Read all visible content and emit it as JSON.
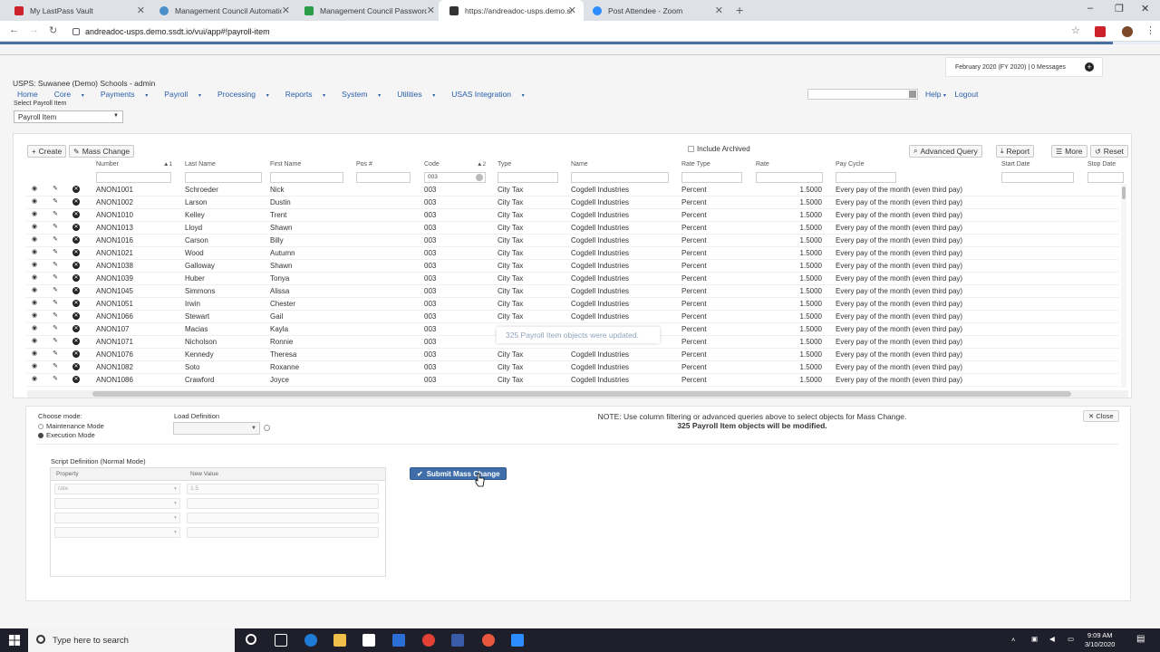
{
  "browser": {
    "tabs": [
      {
        "title": "My LastPass Vault",
        "color": "#cc2229"
      },
      {
        "title": "Management Council Automatio",
        "color": "#4a8fc7"
      },
      {
        "title": "Management Council Password",
        "color": "#2a9d4a"
      },
      {
        "title": "https://andreadoc-usps.demo.ss",
        "color": "#333333"
      },
      {
        "title": "Post Attendee - Zoom",
        "color": "#2d8cff"
      }
    ],
    "url": "andreadoc-usps.demo.ssdt.io/vui/app#!payroll-item"
  },
  "header": {
    "title": "USPS: Suwanee (Demo) Schools - admin",
    "status": "February 2020 (FY 2020) | 0 Messages",
    "menu": [
      "Home",
      "Core",
      "Payments",
      "Payroll",
      "Processing",
      "Reports",
      "System",
      "Utilities",
      "USAS Integration"
    ],
    "help": "Help",
    "logout": "Logout",
    "select_label": "Select Payroll Item",
    "select_value": "Payroll Item"
  },
  "toolbar": {
    "create": "Create",
    "mass_change": "Mass Change",
    "include_archived": "Include Archived",
    "advanced_query": "Advanced Query",
    "report": "Report",
    "more": "More",
    "reset": "Reset"
  },
  "grid": {
    "columns": [
      "Number",
      "Last Name",
      "First Name",
      "Pos #",
      "Code",
      "Type",
      "Name",
      "Rate Type",
      "Rate",
      "Pay Cycle",
      "Start Date",
      "Stop Date"
    ],
    "sort_number": "1",
    "sort_code": "2",
    "code_filter": "003",
    "rows": [
      {
        "number": "ANON1001",
        "last": "Schroeder",
        "first": "Nick",
        "code": "003",
        "type": "City Tax",
        "name": "Cogdell Industries",
        "rate_type": "Percent",
        "rate": "1.5000",
        "cycle": "Every pay of the month (even third pay)"
      },
      {
        "number": "ANON1002",
        "last": "Larson",
        "first": "Dustin",
        "code": "003",
        "type": "City Tax",
        "name": "Cogdell Industries",
        "rate_type": "Percent",
        "rate": "1.5000",
        "cycle": "Every pay of the month (even third pay)"
      },
      {
        "number": "ANON1010",
        "last": "Kelley",
        "first": "Trent",
        "code": "003",
        "type": "City Tax",
        "name": "Cogdell Industries",
        "rate_type": "Percent",
        "rate": "1.5000",
        "cycle": "Every pay of the month (even third pay)"
      },
      {
        "number": "ANON1013",
        "last": "Lloyd",
        "first": "Shawn",
        "code": "003",
        "type": "City Tax",
        "name": "Cogdell Industries",
        "rate_type": "Percent",
        "rate": "1.5000",
        "cycle": "Every pay of the month (even third pay)"
      },
      {
        "number": "ANON1016",
        "last": "Carson",
        "first": "Billy",
        "code": "003",
        "type": "City Tax",
        "name": "Cogdell Industries",
        "rate_type": "Percent",
        "rate": "1.5000",
        "cycle": "Every pay of the month (even third pay)"
      },
      {
        "number": "ANON1021",
        "last": "Wood",
        "first": "Autumn",
        "code": "003",
        "type": "City Tax",
        "name": "Cogdell Industries",
        "rate_type": "Percent",
        "rate": "1.5000",
        "cycle": "Every pay of the month (even third pay)"
      },
      {
        "number": "ANON1038",
        "last": "Galloway",
        "first": "Shawn",
        "code": "003",
        "type": "City Tax",
        "name": "Cogdell Industries",
        "rate_type": "Percent",
        "rate": "1.5000",
        "cycle": "Every pay of the month (even third pay)"
      },
      {
        "number": "ANON1039",
        "last": "Huber",
        "first": "Tonya",
        "code": "003",
        "type": "City Tax",
        "name": "Cogdell Industries",
        "rate_type": "Percent",
        "rate": "1.5000",
        "cycle": "Every pay of the month (even third pay)"
      },
      {
        "number": "ANON1045",
        "last": "Simmons",
        "first": "Alissa",
        "code": "003",
        "type": "City Tax",
        "name": "Cogdell Industries",
        "rate_type": "Percent",
        "rate": "1.5000",
        "cycle": "Every pay of the month (even third pay)"
      },
      {
        "number": "ANON1051",
        "last": "Irwin",
        "first": "Chester",
        "code": "003",
        "type": "City Tax",
        "name": "Cogdell Industries",
        "rate_type": "Percent",
        "rate": "1.5000",
        "cycle": "Every pay of the month (even third pay)"
      },
      {
        "number": "ANON1066",
        "last": "Stewart",
        "first": "Gail",
        "code": "003",
        "type": "City Tax",
        "name": "Cogdell Industries",
        "rate_type": "Percent",
        "rate": "1.5000",
        "cycle": "Every pay of the month (even third pay)"
      },
      {
        "number": "ANON107",
        "last": "Macias",
        "first": "Kayla",
        "code": "003",
        "type": "",
        "name": "",
        "rate_type": "Percent",
        "rate": "1.5000",
        "cycle": "Every pay of the month (even third pay)"
      },
      {
        "number": "ANON1071",
        "last": "Nicholson",
        "first": "Ronnie",
        "code": "003",
        "type": "",
        "name": "",
        "rate_type": "Percent",
        "rate": "1.5000",
        "cycle": "Every pay of the month (even third pay)"
      },
      {
        "number": "ANON1076",
        "last": "Kennedy",
        "first": "Theresa",
        "code": "003",
        "type": "City Tax",
        "name": "Cogdell Industries",
        "rate_type": "Percent",
        "rate": "1.5000",
        "cycle": "Every pay of the month (even third pay)"
      },
      {
        "number": "ANON1082",
        "last": "Soto",
        "first": "Roxanne",
        "code": "003",
        "type": "City Tax",
        "name": "Cogdell Industries",
        "rate_type": "Percent",
        "rate": "1.5000",
        "cycle": "Every pay of the month (even third pay)"
      },
      {
        "number": "ANON1086",
        "last": "Crawford",
        "first": "Joyce",
        "code": "003",
        "type": "City Tax",
        "name": "Cogdell Industries",
        "rate_type": "Percent",
        "rate": "1.5000",
        "cycle": "Every pay of the month (even third pay)"
      }
    ]
  },
  "toast": "325 Payroll Item objects were updated.",
  "mass_change": {
    "choose_mode": "Choose mode:",
    "maintenance_mode": "Maintenance Mode",
    "execution_mode": "Execution Mode",
    "load_definition": "Load Definition",
    "note": "NOTE: Use column filtering or advanced queries above to select objects for Mass Change.",
    "count_note": "325 Payroll Item objects will be modified.",
    "close": "Close",
    "script_title": "Script Definition (Normal Mode)",
    "property_header": "Property",
    "value_header": "New Value",
    "script_rows": [
      {
        "property": "rate",
        "value": "1.5"
      },
      {
        "property": "",
        "value": ""
      },
      {
        "property": "",
        "value": ""
      },
      {
        "property": "",
        "value": ""
      }
    ],
    "submit": "Submit Mass Change"
  },
  "taskbar": {
    "search_placeholder": "Type here to search",
    "time": "9:09 AM",
    "date": "3/10/2020"
  }
}
